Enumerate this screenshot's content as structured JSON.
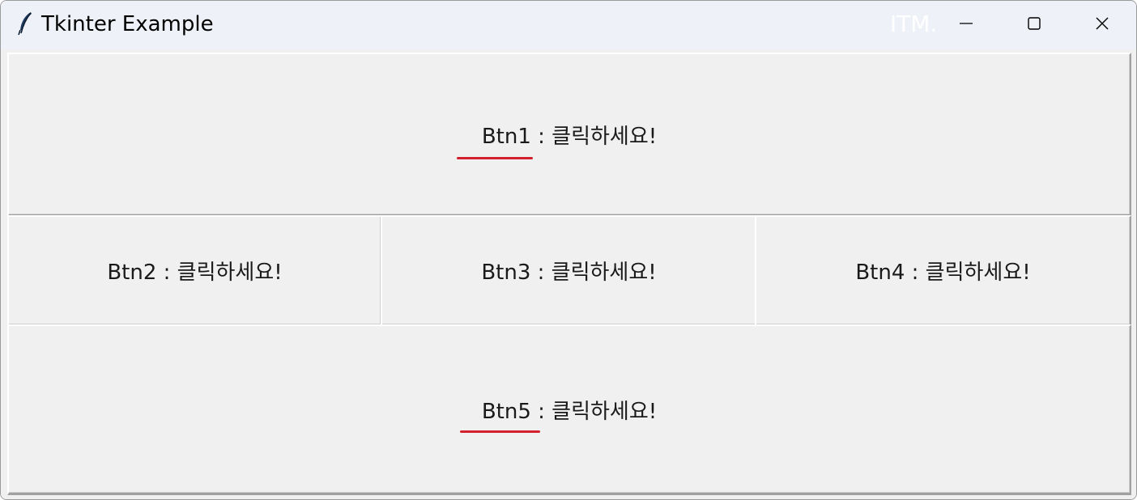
{
  "window": {
    "title": "Tkinter Example",
    "watermark": "ITM."
  },
  "title_controls": {
    "minimize": "minimize",
    "maximize": "maximize",
    "close": "close"
  },
  "buttons": [
    {
      "label": "Btn1 : 클릭하세요!",
      "underlined": true
    },
    {
      "label": "Btn2 : 클릭하세요!",
      "underlined": false
    },
    {
      "label": "Btn3 : 클릭하세요!",
      "underlined": false
    },
    {
      "label": "Btn4 : 클릭하세요!",
      "underlined": false
    },
    {
      "label": "Btn5 : 클릭하세요!",
      "underlined": true
    }
  ],
  "colors": {
    "annotation_underline": "#d2202e",
    "button_face": "#f0f0f0",
    "titlebar": "#eef1f7"
  }
}
